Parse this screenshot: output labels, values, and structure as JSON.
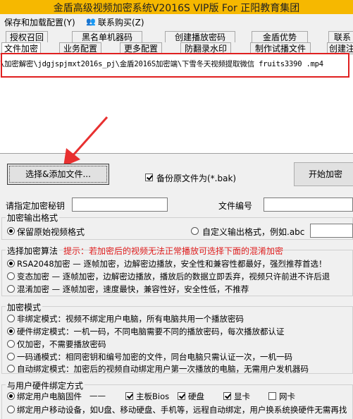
{
  "window": {
    "title": "金盾高级视频加密系统V2016S VIP版 For 正阳教育集团"
  },
  "menu": {
    "items": [
      "保存和加载配置(Y)",
      "联系购买(Z)"
    ]
  },
  "tabs": {
    "row1": [
      "授权召回",
      "黑名单机器码",
      "创建播放密码",
      "金盾优势",
      "联系"
    ],
    "row2": [
      "文件加密",
      "业务配置",
      "更多配置",
      "防翻录水印",
      "制作试播文件",
      "创建注"
    ]
  },
  "files": [
    "\\加密解密\\jdgjspjmxt2016s_pj\\金盾2016S加密端\\下雪冬天视频提取微信 fruits3390 .mp4"
  ],
  "actions": {
    "add_file": "选择&添加文件...",
    "backup": "备份原文件为(*.bak)",
    "start": "开始加密"
  },
  "fields": {
    "password_label": "请指定加密秘钥",
    "password_value": "",
    "file_no_label": "文件编号",
    "file_no_value": ""
  },
  "output_format": {
    "legend": "加密输出格式",
    "keep": "保留原始视频格式",
    "custom": "自定义输出格式，例如.abc",
    "custom_value": ""
  },
  "algorithm": {
    "legend": "选择加密算法",
    "hint": "提示：若加密后的视频无法正常播放可选择下面的混淆加密",
    "options": [
      "RSA2048加密 — 逐帧加密，边解密边播放，安全性和兼容性都最好，强烈推荐首选！",
      "变态加密 — 逐帧加密，边解密边播放，播放后的数据立即丢弃，视频只许前进不许后退",
      "混淆加密 — 逐帧加密，速度最快，兼容性好，安全性低，不推荐"
    ]
  },
  "mode": {
    "legend": "加密模式",
    "options": [
      "非绑定模式：视频不绑定用户电脑，所有电脑共用一个播放密码",
      "硬件绑定模式：一机一码，不同电脑需要不同的播放密码，每次播放都认证",
      "仅加密，不需要播放密码",
      "一码通模式：相同密钥和编号加密的文件，同台电脑只需认证一次，一机一码",
      "自动绑定模式：加密后的视频自动绑定用户第一次播放的电脑，无需用户发机器码"
    ]
  },
  "hardware": {
    "legend": "与用户硬件绑定方式",
    "pc": "绑定用户电脑固件",
    "dash": "——",
    "board": "主板Bios",
    "disk": "硬盘",
    "gpu": "显卡",
    "nic": "网卡",
    "mobile": "绑定用户移动设备，如U盘、移动硬盘、手机等，远程自动绑定，用户换系统换硬件无需再找"
  }
}
